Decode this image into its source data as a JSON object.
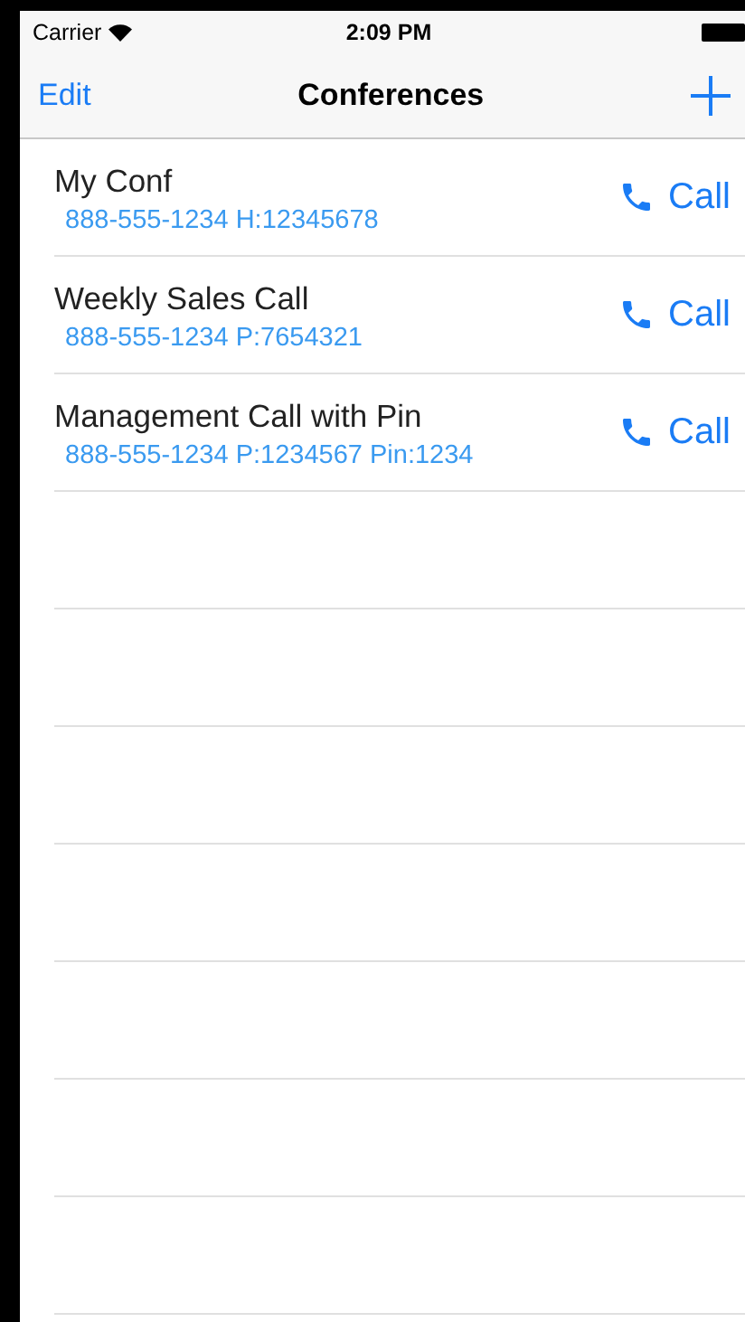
{
  "status_bar": {
    "carrier": "Carrier",
    "time": "2:09 PM"
  },
  "nav_bar": {
    "left_button": "Edit",
    "title": "Conferences"
  },
  "conferences": [
    {
      "name": "My Conf",
      "details": "888-555-1234 H:12345678",
      "action": "Call"
    },
    {
      "name": "Weekly Sales Call",
      "details": "888-555-1234 P:7654321",
      "action": "Call"
    },
    {
      "name": "Management Call with Pin",
      "details": "888-555-1234 P:1234567 Pin:1234",
      "action": "Call"
    }
  ]
}
